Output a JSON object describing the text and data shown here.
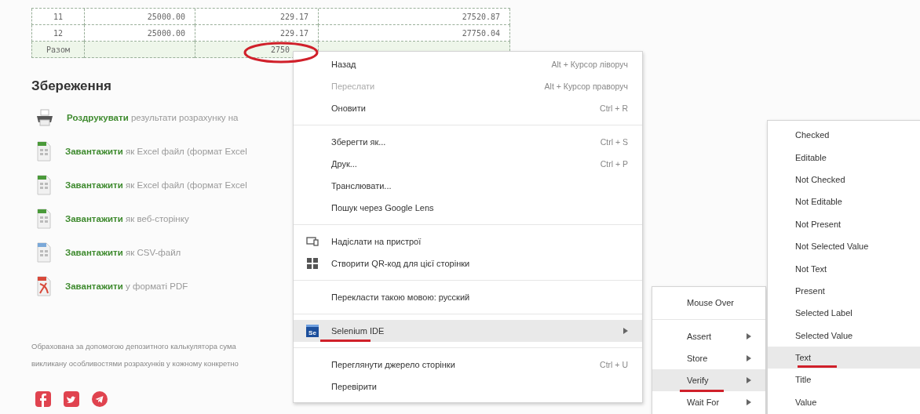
{
  "table": {
    "rows": [
      {
        "cells": [
          "11",
          "25000.00",
          "229.17",
          "27520.87"
        ]
      },
      {
        "cells": [
          "12",
          "25000.00",
          "229.17",
          "27750.04"
        ]
      }
    ],
    "total": {
      "label": "Разом",
      "value": "2750"
    }
  },
  "saving": {
    "title": "Збереження",
    "items": [
      {
        "kind": "print",
        "link": "Роздрукувати",
        "text": "результати розрахунку на"
      },
      {
        "kind": "excel",
        "link": "Завантажити",
        "text": "як Excel файл (формат Excel"
      },
      {
        "kind": "excel",
        "link": "Завантажити",
        "text": "як Excel файл (формат Excel"
      },
      {
        "kind": "web",
        "link": "Завантажити",
        "text": "як веб-сторінку"
      },
      {
        "kind": "csv",
        "link": "Завантажити",
        "text": "як CSV-файл"
      },
      {
        "kind": "pdf",
        "link": "Завантажити",
        "text": "у форматі PDF"
      }
    ],
    "note": [
      "Обрахована за допомогою депозитного калькулятора сума",
      "викликану особливостями розрахунків у кожному конкретно"
    ],
    "social": [
      {
        "kind": "facebook"
      },
      {
        "kind": "twitter"
      },
      {
        "kind": "telegram"
      }
    ]
  },
  "context_menu": {
    "groups": [
      [
        {
          "label": "Назад",
          "shortcut": "Alt + Курсор ліворуч",
          "disabled": false,
          "highlighted": false,
          "submenu": false
        },
        {
          "label": "Переслати",
          "shortcut": "Alt + Курсор праворуч",
          "disabled": true,
          "highlighted": false,
          "submenu": false
        },
        {
          "label": "Оновити",
          "shortcut": "Ctrl + R",
          "disabled": false,
          "highlighted": false,
          "submenu": false
        }
      ],
      [
        {
          "label": "Зберегти як...",
          "shortcut": "Ctrl + S",
          "disabled": false,
          "highlighted": false,
          "submenu": false
        },
        {
          "label": "Друк...",
          "shortcut": "Ctrl + P",
          "disabled": false,
          "highlighted": false,
          "submenu": false
        },
        {
          "label": "Транслювати...",
          "disabled": false,
          "highlighted": false,
          "submenu": false
        },
        {
          "label": "Пошук через Google Lens",
          "disabled": false,
          "highlighted": false,
          "submenu": false
        }
      ],
      [
        {
          "label": "Надіслати на пристрої",
          "icon": {
            "kind": "device"
          },
          "disabled": false,
          "highlighted": false,
          "submenu": false
        },
        {
          "label": "Створити QR-код для цієї сторінки",
          "icon": {
            "kind": "qr"
          },
          "disabled": false,
          "highlighted": false,
          "submenu": false
        }
      ],
      [
        {
          "label": "Перекласти такою мовою: русский",
          "disabled": false,
          "highlighted": false,
          "submenu": false
        }
      ],
      [
        {
          "label": "Selenium IDE",
          "icon": {
            "kind": "selenium",
            "text": "Se"
          },
          "disabled": false,
          "highlighted": true,
          "submenu": true
        }
      ],
      [
        {
          "label": "Переглянути джерело сторінки",
          "shortcut": "Ctrl + U",
          "disabled": false,
          "highlighted": false,
          "submenu": false
        },
        {
          "label": "Перевірити",
          "disabled": false,
          "highlighted": false,
          "submenu": false
        }
      ]
    ]
  },
  "selenium_menu": {
    "groups": [
      [
        {
          "label": "Mouse Over",
          "selected": false,
          "submenu": false
        }
      ],
      [
        {
          "label": "Assert",
          "selected": false,
          "submenu": true
        },
        {
          "label": "Store",
          "selected": false,
          "submenu": true
        },
        {
          "label": "Verify",
          "selected": true,
          "submenu": true
        },
        {
          "label": "Wait For",
          "selected": false,
          "submenu": true
        }
      ]
    ]
  },
  "verify_menu": {
    "items": [
      {
        "label": "Checked",
        "selected": false
      },
      {
        "label": "Editable",
        "selected": false
      },
      {
        "label": "Not Checked",
        "selected": false
      },
      {
        "label": "Not Editable",
        "selected": false
      },
      {
        "label": "Not Present",
        "selected": false
      },
      {
        "label": "Not Selected Value",
        "selected": false
      },
      {
        "label": "Not Text",
        "selected": false
      },
      {
        "label": "Present",
        "selected": false
      },
      {
        "label": "Selected Label",
        "selected": false
      },
      {
        "label": "Selected Value",
        "selected": false
      },
      {
        "label": "Text",
        "selected": true
      },
      {
        "label": "Title",
        "selected": false
      },
      {
        "label": "Value",
        "selected": false
      }
    ]
  }
}
